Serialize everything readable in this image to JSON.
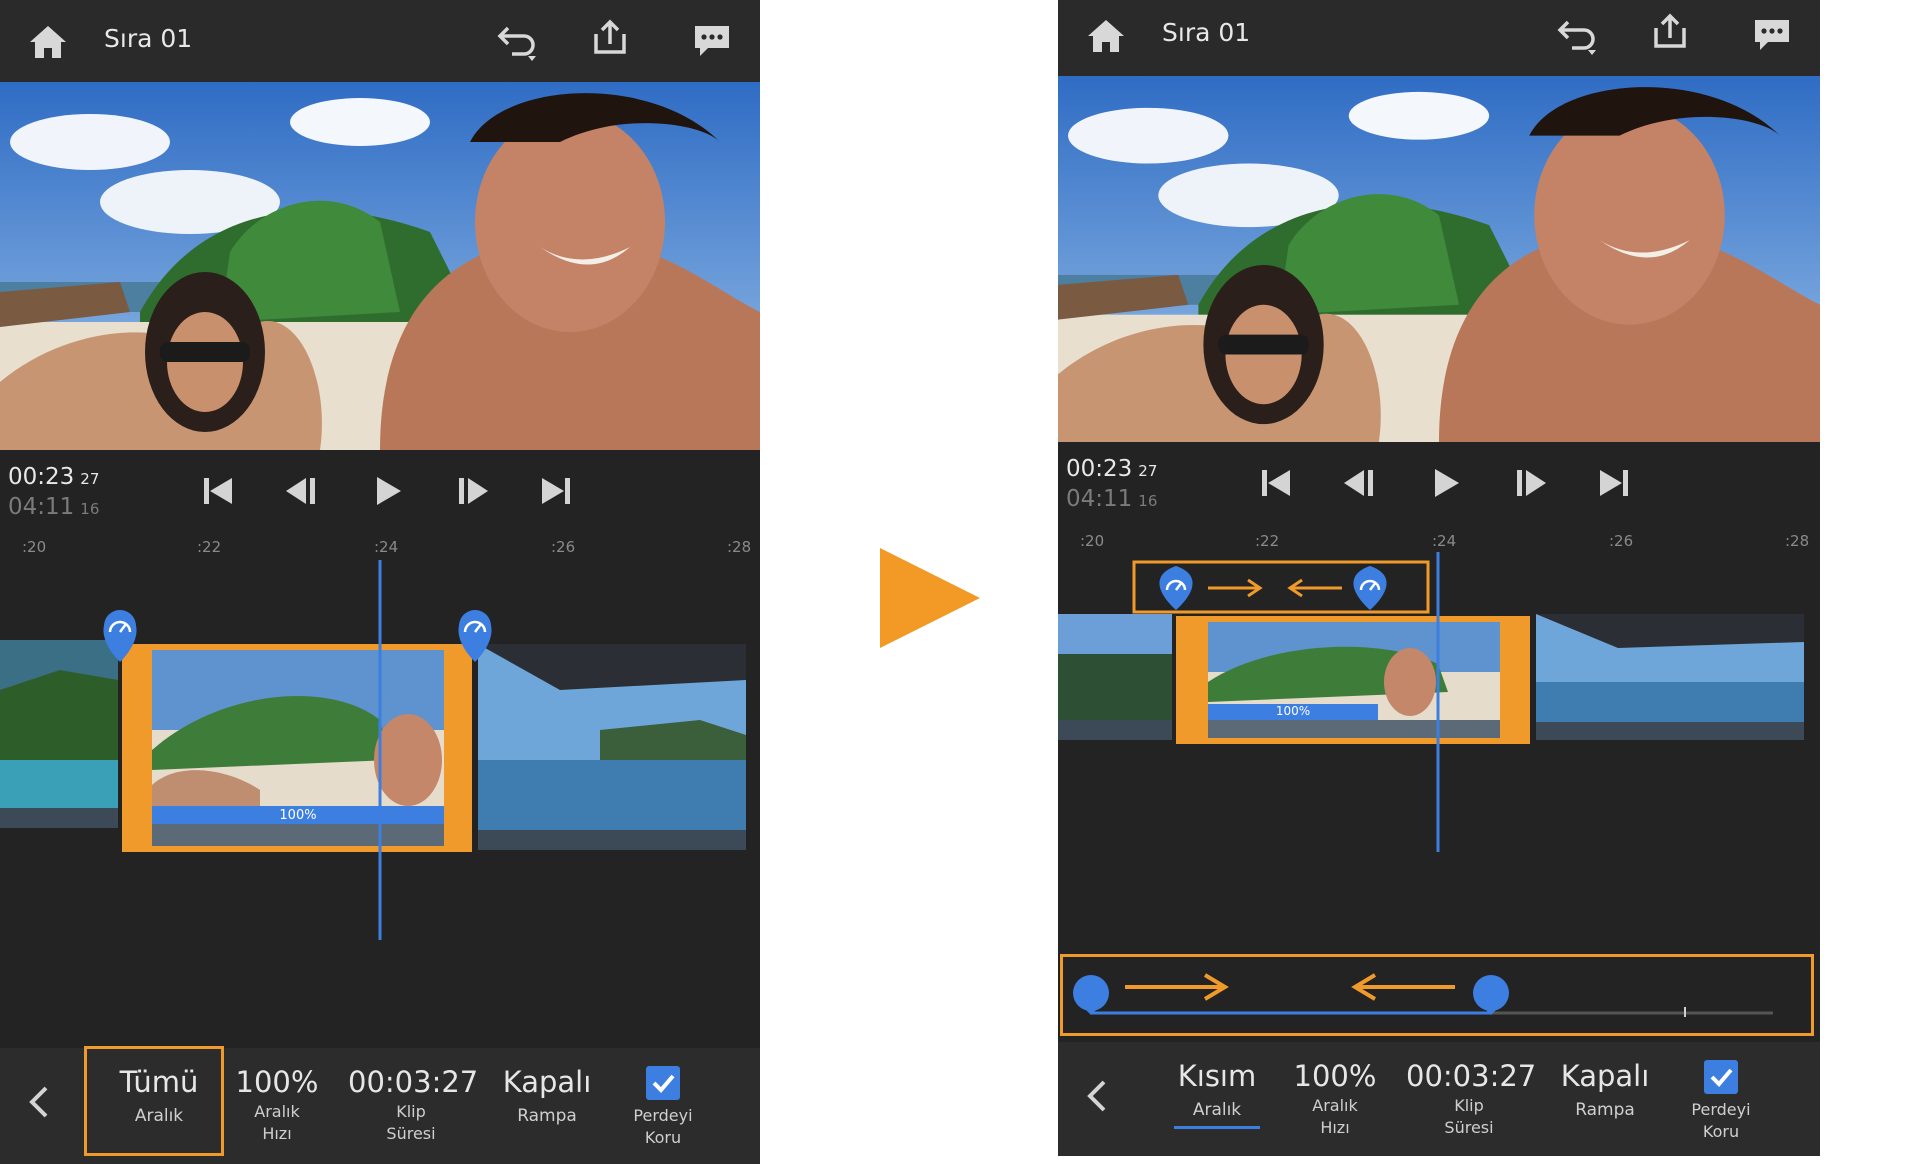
{
  "colors": {
    "accent": "#3d7fe0",
    "highlight": "#ef9a2a",
    "panel": "#232323",
    "topbar": "#2a2a2a"
  },
  "icons": {
    "home": "home-icon",
    "undo": "undo-icon",
    "share": "share-icon",
    "chat": "chat-icon",
    "skip_start": "skip-start-icon",
    "step_back": "step-back-icon",
    "play": "play-icon",
    "step_forward": "step-forward-icon",
    "skip_end": "skip-end-icon",
    "speed_marker": "speedometer-icon",
    "back": "chevron-left-icon",
    "check": "checkbox-checked-icon",
    "flow": "play-arrow-icon"
  },
  "left": {
    "title": "Sıra 01",
    "current_time": "00:23",
    "current_frames": "27",
    "total_time": "04:11",
    "total_frames": "16",
    "ruler": [
      ":20",
      ":22",
      ":24",
      ":26",
      ":28"
    ],
    "clip_speed": "100%",
    "options": [
      {
        "value": "Tümü",
        "label": "Aralık",
        "label2": ""
      },
      {
        "value": "100%",
        "label": "Aralık",
        "label2": "Hızı"
      },
      {
        "value": "00:03:27",
        "label": "Klip",
        "label2": "Süresi"
      },
      {
        "value": "Kapalı",
        "label": "Rampa",
        "label2": ""
      },
      {
        "value": "",
        "label": "Perdeyi",
        "label2": "Koru"
      }
    ]
  },
  "right": {
    "title": "Sıra 01",
    "current_time": "00:23",
    "current_frames": "27",
    "total_time": "04:11",
    "total_frames": "16",
    "ruler": [
      ":20",
      ":22",
      ":24",
      ":26",
      ":28"
    ],
    "clip_speed": "100%",
    "options": [
      {
        "value": "Kısım",
        "label": "Aralık",
        "label2": ""
      },
      {
        "value": "100%",
        "label": "Aralık",
        "label2": "Hızı"
      },
      {
        "value": "00:03:27",
        "label": "Klip",
        "label2": "Süresi"
      },
      {
        "value": "Kapalı",
        "label": "Rampa",
        "label2": ""
      },
      {
        "value": "",
        "label": "Perdeyi",
        "label2": "Koru"
      }
    ]
  }
}
